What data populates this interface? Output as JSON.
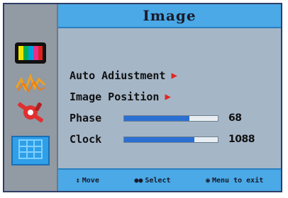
{
  "osd": {
    "title": "Image",
    "menu": {
      "auto_adjustment": "Auto Adiustment",
      "image_position": "Image Position",
      "phase": {
        "label": "Phase",
        "value": "68",
        "level": 0.7
      },
      "clock": {
        "label": "Clock",
        "value": "1088",
        "level": 0.75
      }
    },
    "footer": {
      "move": "Move",
      "select": "Select",
      "exit": "Menu to exit"
    },
    "sidebar_icons": [
      "color-bars-icon",
      "signal-wave-icon",
      "tools-icon",
      "image-grid-icon"
    ],
    "colors": {
      "accent": "#4aa9e6",
      "active_item": "#2f9fe8",
      "slider_fill": "#2b6fd3",
      "arrow": "#e2251e"
    }
  }
}
